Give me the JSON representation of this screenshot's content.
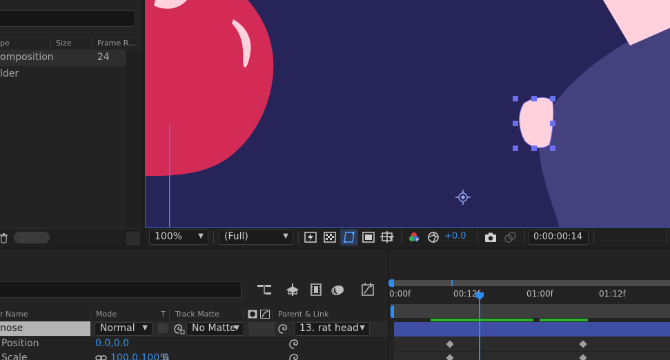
{
  "project_panel": {
    "columns": [
      "pe",
      "Size",
      "Frame R..."
    ],
    "rows": [
      {
        "name": "omposition",
        "frame_rate": "24"
      },
      {
        "name": "lder",
        "frame_rate": ""
      }
    ]
  },
  "viewer": {
    "zoom": "100%",
    "resolution": "(Full)",
    "exposure": "+0.0",
    "timecode": "0:00:00:14"
  },
  "timeline": {
    "columns": {
      "layer_name": "r Name",
      "mode": "Mode",
      "t": "T",
      "track_matte": "Track Matte",
      "parent_link": "Parent & Link"
    },
    "layer": {
      "name": "nose",
      "mode": "Normal",
      "track_matte": "No Matte",
      "parent": "13. rat head"
    },
    "properties": [
      {
        "name": "Position",
        "value": "0.0,0.0"
      },
      {
        "name": "Scale",
        "value": "100.0,100.0",
        "unit": "%"
      }
    ],
    "ruler": [
      "0:00f",
      "00:12f",
      "01:00f",
      "01:12f"
    ]
  },
  "colors": {
    "accent": "#2e8bf0",
    "layer_bar": "#3e4ea2",
    "comp_bg": "#27245a",
    "apple_red": "#d42a56",
    "shape_pink": "#ffd1dc"
  }
}
